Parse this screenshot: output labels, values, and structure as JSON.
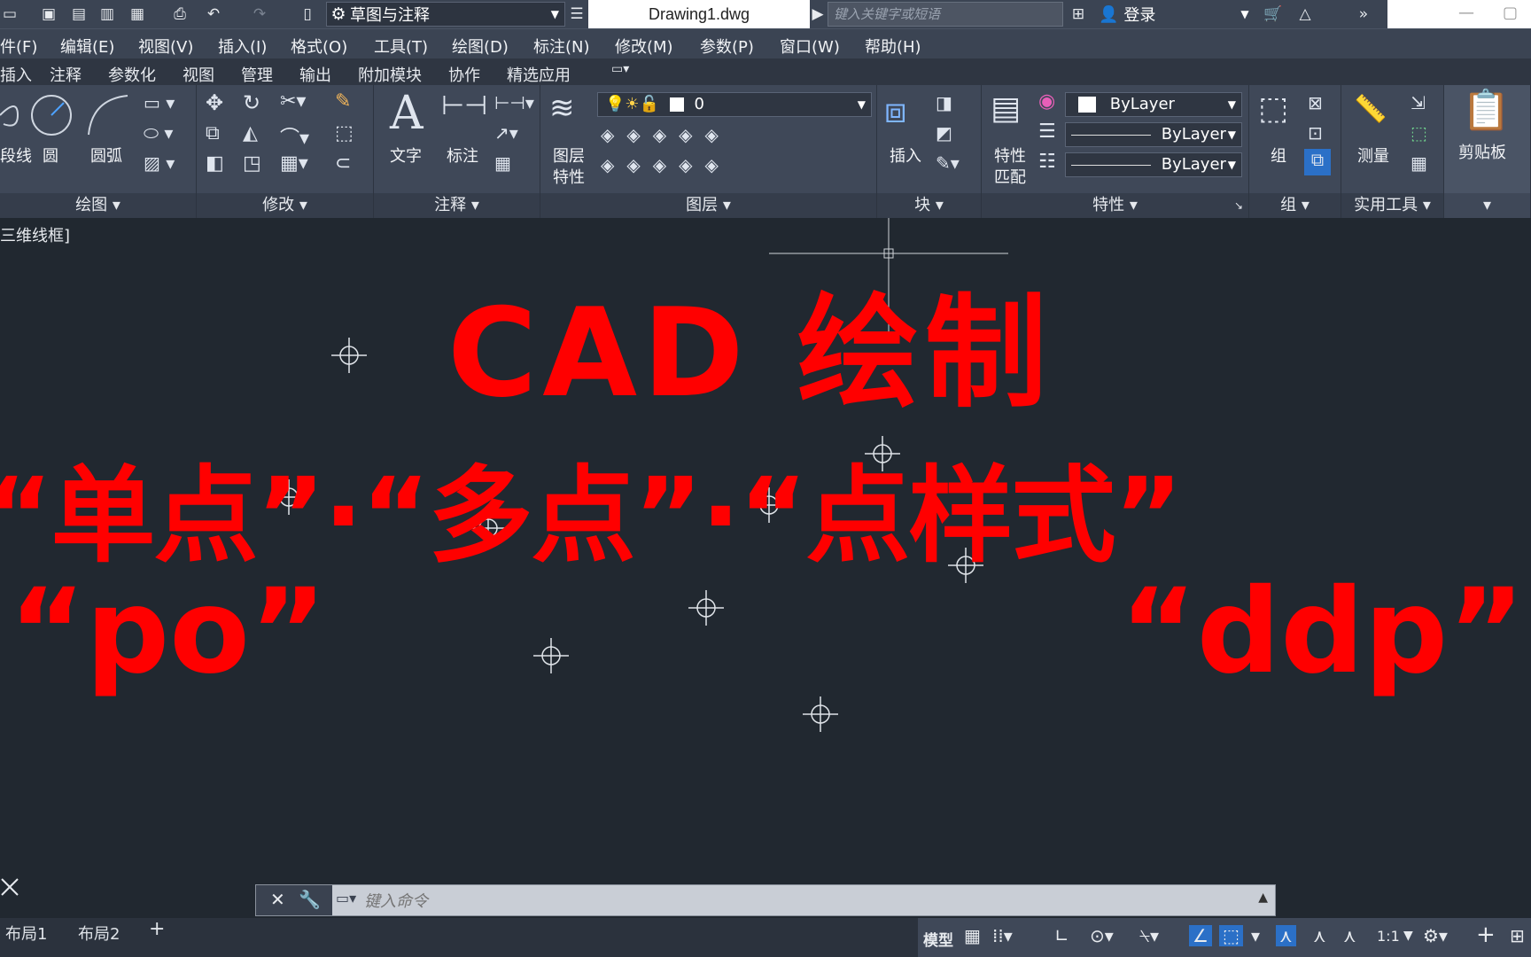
{
  "titlebar": {
    "workspace": "草图与注释",
    "document_tab": "Drawing1.dwg",
    "search_placeholder": "键入关键字或短语",
    "login": "登录"
  },
  "menu": [
    "件(F)",
    "编辑(E)",
    "视图(V)",
    "插入(I)",
    "格式(O)",
    "工具(T)",
    "绘图(D)",
    "标注(N)",
    "修改(M)",
    "参数(P)",
    "窗口(W)",
    "帮助(H)"
  ],
  "ribbon_tabs": [
    "插入",
    "注释",
    "参数化",
    "视图",
    "管理",
    "输出",
    "附加模块",
    "协作",
    "精选应用"
  ],
  "ribbon": {
    "draw": {
      "title": "绘图",
      "polyline": "段线",
      "circle": "圆",
      "arc": "圆弧"
    },
    "modify": {
      "title": "修改"
    },
    "annotation": {
      "title": "注释",
      "text": "文字",
      "dimension": "标注"
    },
    "layers": {
      "title": "图层",
      "layer_props_line1": "图层",
      "layer_props_line2": "特性",
      "current_layer": "0"
    },
    "block": {
      "title": "块",
      "insert": "插入"
    },
    "properties": {
      "title": "特性",
      "match_line1": "特性",
      "match_line2": "匹配",
      "color": "ByLayer",
      "linetype": "ByLayer",
      "lineweight": "ByLayer"
    },
    "groups": {
      "title": "组",
      "group": "组"
    },
    "utilities": {
      "title": "实用工具",
      "measure": "测量"
    },
    "clipboard": {
      "paste": "剪贴板"
    }
  },
  "viewport_label": "三维线框]",
  "overlay": {
    "line1": "CAD 绘制",
    "line2": "“单点”·“多点”·“点样式”",
    "line3_left": "“po”",
    "line3_right": "“ddp”"
  },
  "command": {
    "placeholder": "键入命令"
  },
  "status": {
    "layout1": "布局1",
    "layout2": "布局2",
    "add": "+",
    "model": "模型",
    "scale": "1:1"
  }
}
